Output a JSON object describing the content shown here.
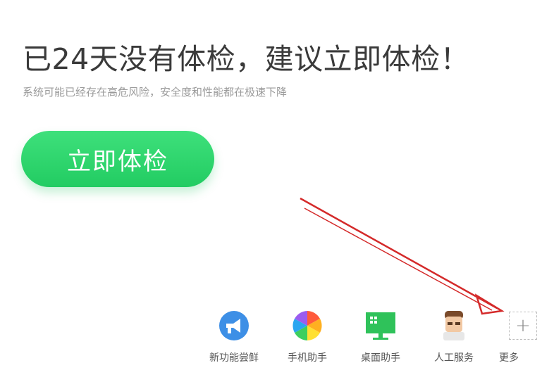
{
  "main": {
    "headline": "已24天没有体检，建议立即体检！",
    "subline": "系统可能已经存在高危风险，安全度和性能都在极速下降",
    "scan_button": "立即体检"
  },
  "toolbar": {
    "items": [
      {
        "label": "新功能尝鲜",
        "icon": "megaphone-icon"
      },
      {
        "label": "手机助手",
        "icon": "phone-assistant-icon"
      },
      {
        "label": "桌面助手",
        "icon": "desktop-monitor-icon"
      },
      {
        "label": "人工服务",
        "icon": "support-agent-icon"
      },
      {
        "label": "更多",
        "icon": "plus-icon"
      }
    ]
  },
  "colors": {
    "accent_green": "#2bd46a",
    "arrow_red": "#d42a2a",
    "headline_text": "#3a3a3a",
    "subline_text": "#9a9a9a"
  }
}
